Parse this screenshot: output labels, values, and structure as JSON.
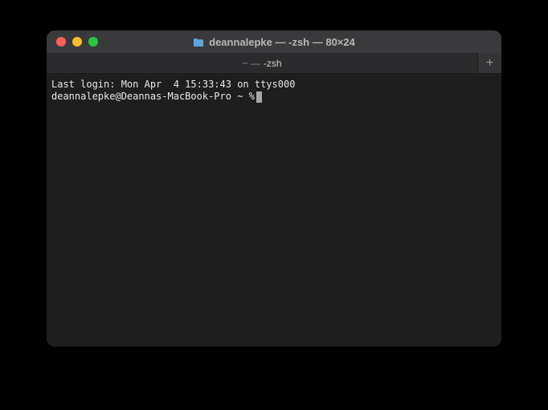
{
  "window": {
    "title": "deannalepke — -zsh — 80×24"
  },
  "tab": {
    "prefix": "~ —",
    "name": "-zsh"
  },
  "newTabLabel": "+",
  "terminal": {
    "lastLogin": "Last login: Mon Apr  4 15:33:43 on ttys000",
    "prompt": "deannalepke@Deannas-MacBook-Pro ~ %"
  }
}
